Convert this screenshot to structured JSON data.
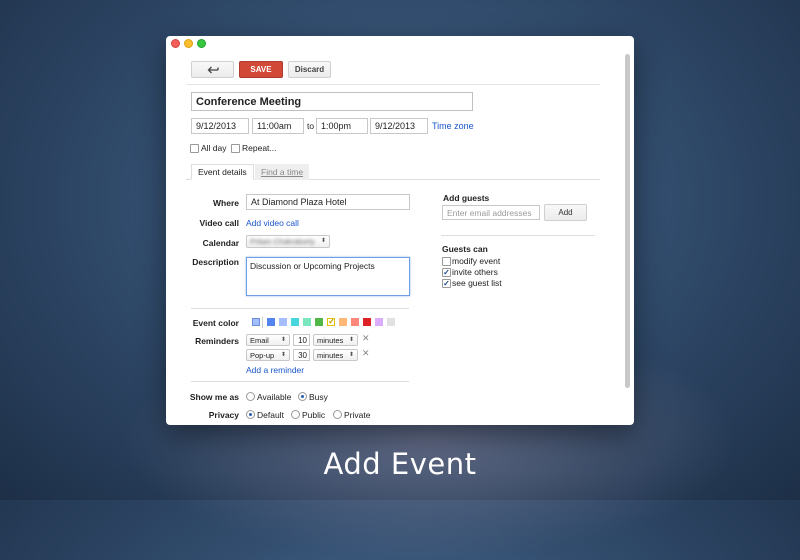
{
  "toolbar": {
    "back_icon": "back-arrow-icon",
    "save_label": "SAVE",
    "discard_label": "Discard"
  },
  "event": {
    "title": "Conference Meeting",
    "start_date": "9/12/2013",
    "start_time": "11:00am",
    "to_label": "to",
    "end_time": "1:00pm",
    "end_date": "9/12/2013",
    "timezone_link": "Time zone"
  },
  "options": {
    "all_day_label": "All day",
    "repeat_label": "Repeat..."
  },
  "tabs": [
    {
      "label": "Event details",
      "active": true
    },
    {
      "label": "Find a time",
      "active": false
    }
  ],
  "details": {
    "where_label": "Where",
    "where_value": "At Diamond Plaza Hotel",
    "video_call_label": "Video call",
    "video_call_link": "Add video call",
    "calendar_label": "Calendar",
    "calendar_value": "Pritam Chakraborty",
    "description_label": "Description",
    "description_value": "Discussion or Upcoming Projects",
    "event_color_label": "Event color",
    "event_colors": [
      "#a4bdfc",
      "#5484ed",
      "#a4bdfc",
      "#46d6db",
      "#7ae7bf",
      "#51b749",
      "#fbd75b",
      "#ffb878",
      "#ff887c",
      "#dc2127",
      "#dbadff",
      "#e1e1e1"
    ],
    "reminders_label": "Reminders",
    "reminders": [
      {
        "method": "Email",
        "value": "10",
        "unit": "minutes"
      },
      {
        "method": "Pop-up",
        "value": "30",
        "unit": "minutes"
      }
    ],
    "add_reminder_link": "Add a reminder",
    "show_me_as_label": "Show me as",
    "available_label": "Available",
    "busy_label": "Busy",
    "privacy_label": "Privacy",
    "privacy_default": "Default",
    "privacy_public": "Public",
    "privacy_private": "Private"
  },
  "guests": {
    "add_guests_label": "Add guests",
    "email_placeholder": "Enter email addresses",
    "add_button": "Add",
    "guests_can_label": "Guests can",
    "permissions": [
      {
        "label": "modify event",
        "checked": false
      },
      {
        "label": "invite others",
        "checked": true
      },
      {
        "label": "see guest list",
        "checked": true
      }
    ]
  },
  "caption": "Add Event"
}
